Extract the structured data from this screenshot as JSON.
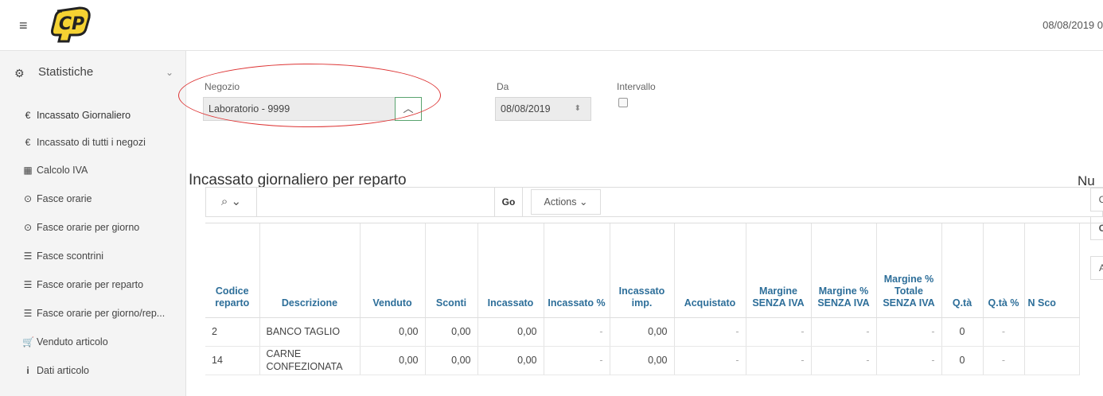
{
  "header": {
    "date": "08/08/2019 0"
  },
  "sidebar": {
    "section_label": "Statistiche",
    "items": [
      {
        "icon": "€",
        "label": "Incassato Giornaliero"
      },
      {
        "icon": "€",
        "label": "Incassato di tutti i negozi"
      },
      {
        "icon": "▦",
        "label": "Calcolo IVA"
      },
      {
        "icon": "⊙",
        "label": "Fasce orarie"
      },
      {
        "icon": "⊙",
        "label": "Fasce orarie per giorno"
      },
      {
        "icon": "☰",
        "label": "Fasce scontrini"
      },
      {
        "icon": "☰",
        "label": "Fasce orarie per reparto"
      },
      {
        "icon": "☰",
        "label": "Fasce orarie per giorno/rep..."
      },
      {
        "icon": "🛒",
        "label": "Venduto articolo"
      },
      {
        "icon": "i",
        "label": "Dati articolo"
      }
    ]
  },
  "filters": {
    "negozio_label": "Negozio",
    "negozio_value": "Laboratorio - 9999",
    "da_label": "Da",
    "da_value": "08/08/2019",
    "intervallo_label": "Intervallo"
  },
  "report": {
    "title": "Incassato giornaliero per reparto",
    "right_title": "Nu",
    "toolbar": {
      "go_label": "Go",
      "actions_label": "Actions"
    },
    "side_buttons": [
      "C",
      "C",
      "A"
    ],
    "columns": [
      "Codice reparto",
      "Descrizione",
      "Venduto",
      "Sconti",
      "Incassato",
      "Incassato %",
      "Incassato imp.",
      "Acquistato",
      "Margine SENZA IVA",
      "Margine % SENZA IVA",
      "Margine % Totale SENZA IVA",
      "Q.tà",
      "Q.tà %",
      "N Sco"
    ],
    "rows": [
      [
        "2",
        "BANCO TAGLIO",
        "0,00",
        "0,00",
        "0,00",
        "-",
        "0,00",
        "-",
        "-",
        "-",
        "-",
        "0",
        "-",
        ""
      ],
      [
        "14",
        "CARNE CONFEZIONATA",
        "0,00",
        "0,00",
        "0,00",
        "-",
        "0,00",
        "-",
        "-",
        "-",
        "-",
        "0",
        "-",
        ""
      ]
    ]
  },
  "colors": {
    "header_text": "#2d6e99",
    "annotation": "#dd3333",
    "button_border": "#5aa46f"
  }
}
